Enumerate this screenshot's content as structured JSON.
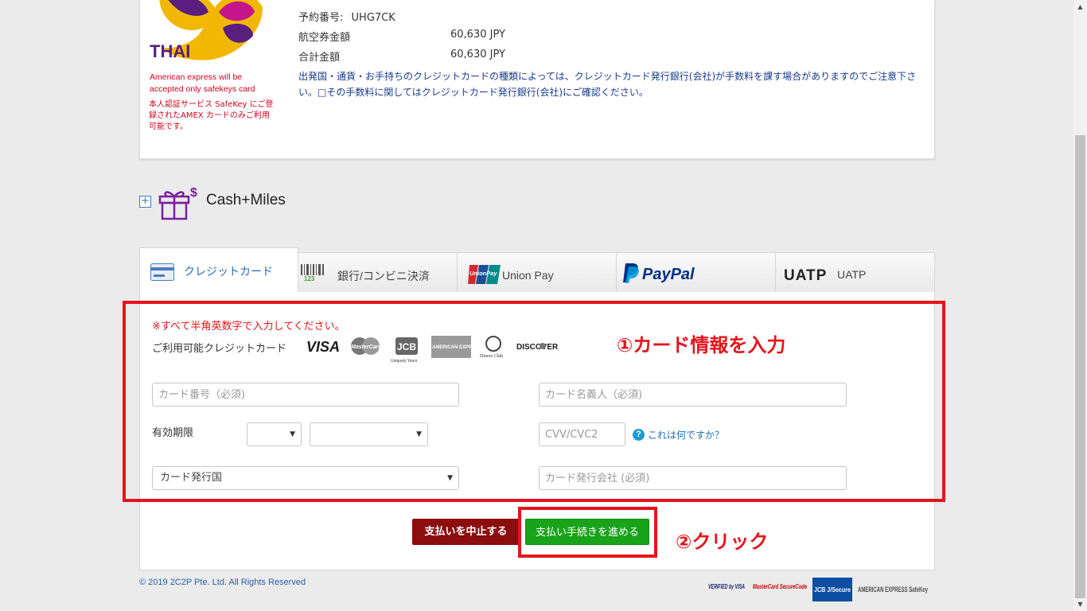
{
  "booking": {
    "reservation_label": "予約番号:",
    "reservation_value": "UHG7CK",
    "fare_label": "航空券金額",
    "fare_value": "60,630 JPY",
    "total_label": "合計金額",
    "total_value": "60,630 JPY",
    "fee_note": "出発国・通貨・お手持ちのクレジットカードの種類によっては、クレジットカード発行銀行(会社)が手数料を課す場合がありますのでご注意下さい。□その手数料に関してはクレジットカード発行銀行(会社)にご確認ください。"
  },
  "airline": {
    "logo_text": "THAI",
    "amex_note": "American express will be accepted only safekeys card",
    "safekey_note": "本人認証サービス SafeKey にご登録されたAMEX カードのみご利用可能です。"
  },
  "cash_miles": {
    "toggle": "+",
    "label": "Cash+Miles"
  },
  "tabs": [
    {
      "label": "クレジットカード",
      "active": true
    },
    {
      "label": "銀行/コンビニ決済",
      "active": false
    },
    {
      "label": "Union Pay",
      "active": false
    },
    {
      "label": "PayPal",
      "active": false
    },
    {
      "label": "UATP",
      "active": false
    }
  ],
  "tab_logos": {
    "unionpay_text": "UnionPay",
    "paypal_text": "PayPal",
    "uatp_text": "UATP"
  },
  "form": {
    "warning": "※すべて半角英数字で入力してください。",
    "accepted_cards_label": "ご利用可能クレジットカード",
    "accepted_cards": [
      "VISA",
      "MasterCard",
      "JCB",
      "AMERICAN EXPRESS",
      "Diners Club",
      "DISCOVER"
    ],
    "card_number_placeholder": "カード番号（必須)",
    "card_holder_placeholder": "カード名義人（必須)",
    "expiry_label": "有効期限",
    "cvv_placeholder": "CVV/CVC2",
    "cvv_help": "これは何ですか？",
    "help_icon_glyph": "?",
    "issuing_country": "カード発行国",
    "issuer_placeholder": "カード発行会社 (必須)"
  },
  "annotations": {
    "step1": "①カード情報を入力",
    "step2": "②クリック"
  },
  "buttons": {
    "cancel": "支払いを中止する",
    "proceed": "支払い手続きを進める"
  },
  "footer": {
    "copyright": "© 2019 2C2P Pte. Ltd. All Rights Reserved",
    "secure_logos": [
      "VERIFIED by VISA",
      "MasterCard SecureCode",
      "JCB J/Secure",
      "AMERICAN EXPRESS SafeKey"
    ]
  },
  "colors": {
    "accent_red": "#e5141b",
    "cancel_button": "#8b0d0d",
    "proceed_button": "#19a31b",
    "link_blue": "#1a6fb5",
    "thai_purple": "#5a1e7e",
    "thai_gold": "#f2b705"
  },
  "icons": {
    "gift": "gift-icon",
    "credit_card": "credit-card-icon",
    "barcode": "barcode-icon",
    "help": "help-icon"
  }
}
